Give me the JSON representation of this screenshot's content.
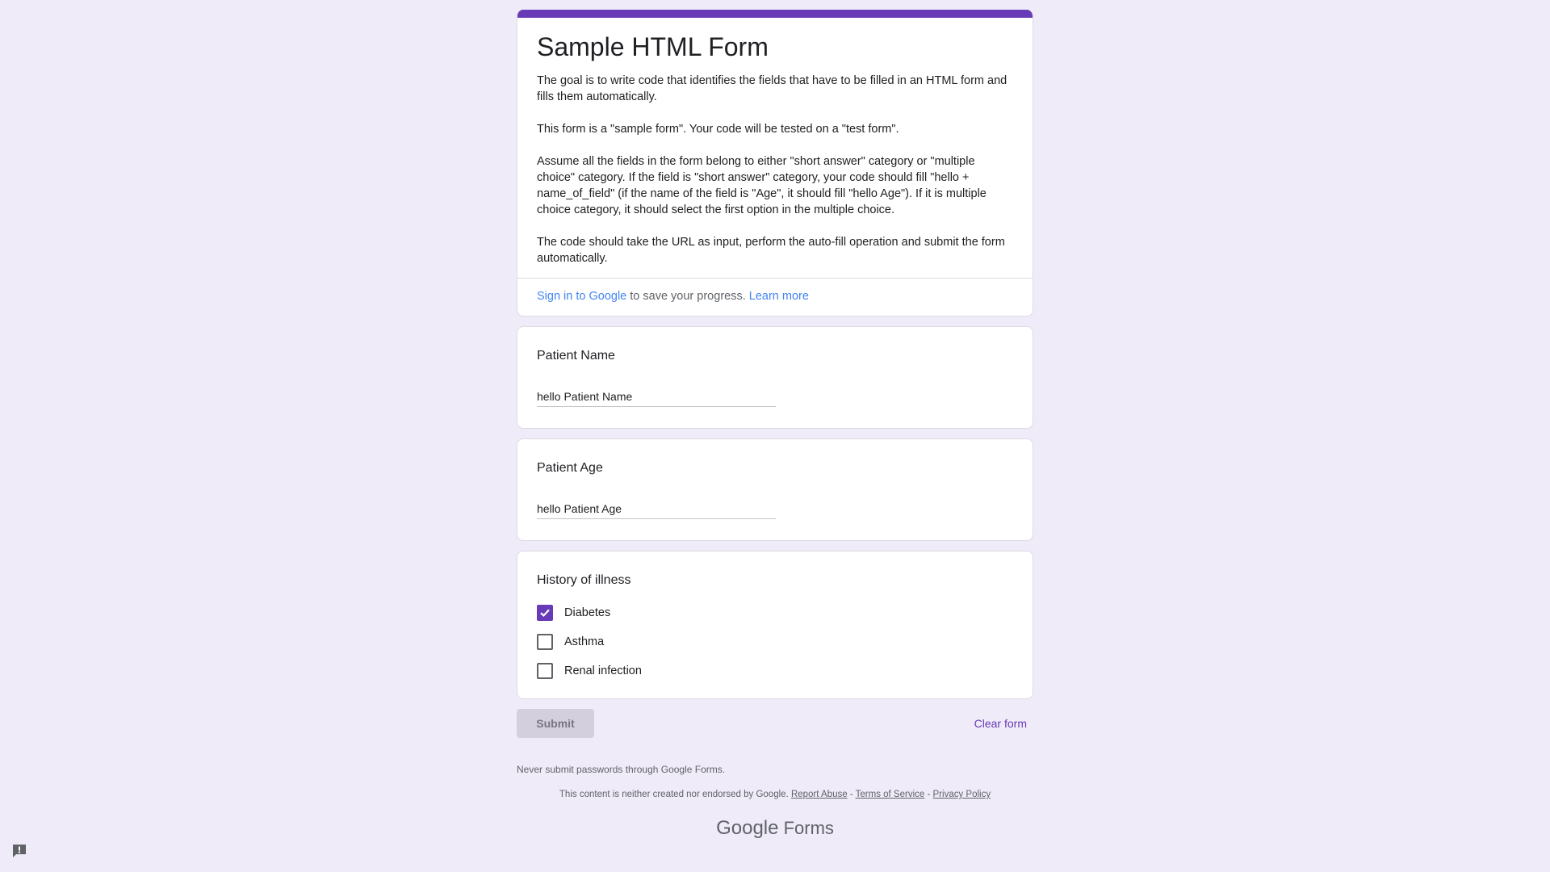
{
  "header": {
    "title": "Sample HTML Form",
    "paragraphs": [
      "The goal is to write code that identifies the fields that have to be filled in an HTML form and fills them automatically.",
      "This form is a \"sample form\". Your code will be tested on a \"test form\".",
      "Assume all the fields in the form belong to either \"short answer\" category or \"multiple choice\" category. If the field is \"short answer\" category, your code should fill \"hello + name_of_field\" (if the name of the field is \"Age\", it should fill \"hello Age\"). If it is multiple choice category, it should select the first option in the multiple choice.",
      "The code should take the URL as input, perform the auto-fill operation and submit the form automatically."
    ],
    "signin_link": "Sign in to Google",
    "signin_text": " to save your progress. ",
    "learn_more": "Learn more",
    "accent_color": "#673ab7"
  },
  "questions": {
    "name": {
      "title": "Patient Name",
      "value": "hello Patient Name"
    },
    "age": {
      "title": "Patient Age",
      "value": "hello Patient Age"
    },
    "history": {
      "title": "History of illness",
      "options": [
        {
          "label": "Diabetes",
          "checked": true
        },
        {
          "label": "Asthma",
          "checked": false
        },
        {
          "label": "Renal infection",
          "checked": false
        }
      ]
    }
  },
  "actions": {
    "submit": "Submit",
    "clear": "Clear form"
  },
  "footer": {
    "never": "Never submit passwords through Google Forms.",
    "disclaimer": "This content is neither created nor endorsed by Google. ",
    "report": "Report Abuse",
    "tos": "Terms of Service",
    "privacy": "Privacy Policy",
    "sep": " - ",
    "brand_google": "Google",
    "brand_forms": " Forms"
  }
}
